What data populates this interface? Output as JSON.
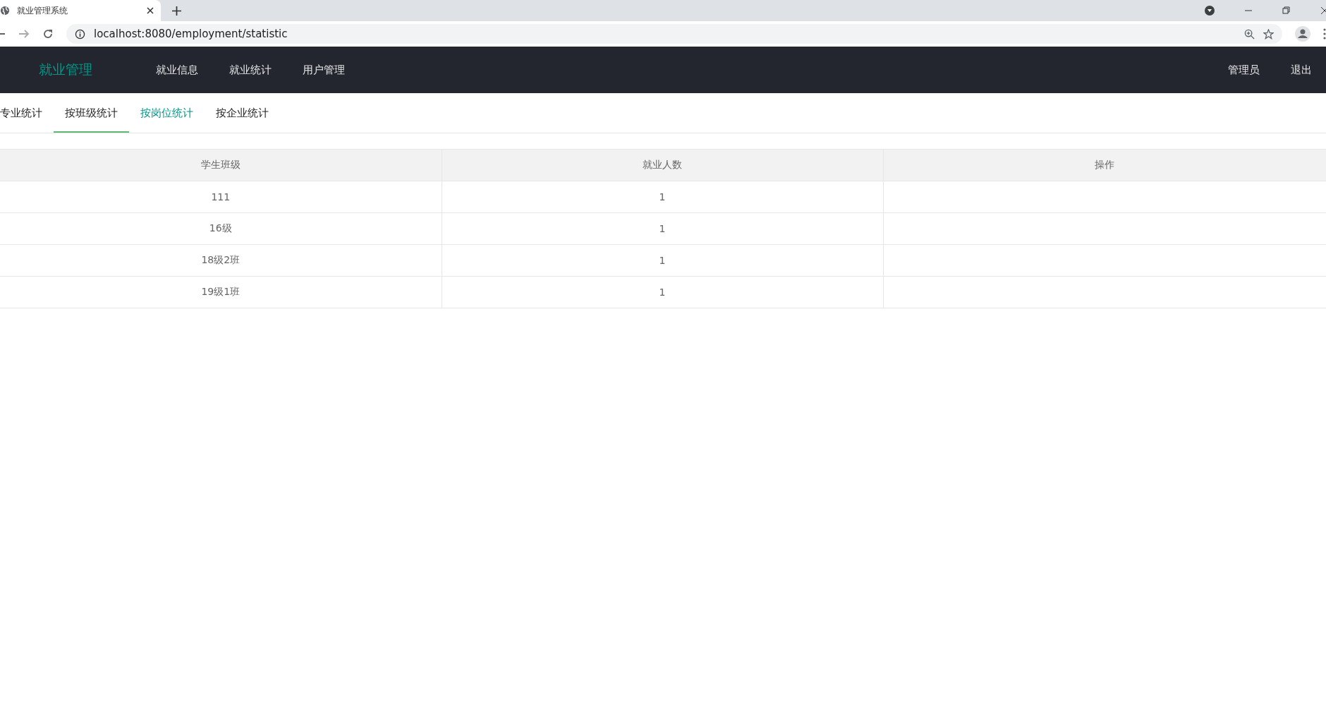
{
  "browser": {
    "tab_title": "就业管理系统",
    "url": "localhost:8080/employment/statistic"
  },
  "navbar": {
    "brand": "就业管理",
    "items": [
      {
        "label": "就业信息"
      },
      {
        "label": "就业统计"
      },
      {
        "label": "用户管理"
      }
    ],
    "user": "管理员",
    "logout": "退出"
  },
  "tabs": [
    {
      "label": "专业统计",
      "selected": false,
      "hovered": false
    },
    {
      "label": "按班级统计",
      "selected": true,
      "hovered": false
    },
    {
      "label": "按岗位统计",
      "selected": false,
      "hovered": true
    },
    {
      "label": "按企业统计",
      "selected": false,
      "hovered": false
    }
  ],
  "table": {
    "columns": [
      "学生班级",
      "就业人数",
      "操作"
    ],
    "rows": [
      {
        "class": "111",
        "count": "1"
      },
      {
        "class": "16级",
        "count": "1"
      },
      {
        "class": "18级2班",
        "count": "1"
      },
      {
        "class": "19级1班",
        "count": "1"
      }
    ]
  }
}
